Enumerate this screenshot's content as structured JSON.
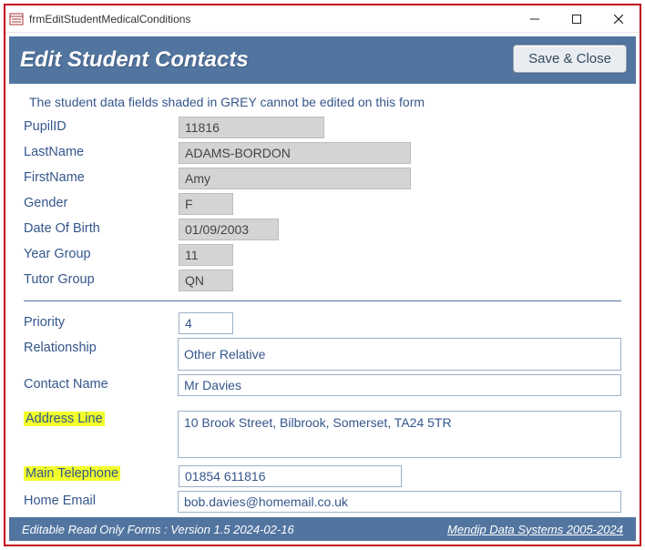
{
  "window": {
    "title": "frmEditStudentMedicalConditions"
  },
  "header": {
    "title": "Edit Student Contacts",
    "save_label": "Save & Close"
  },
  "notice": "The student data fields shaded in GREY cannot be edited on this form",
  "labels": {
    "pupil_id": "PupilID",
    "last_name": "LastName",
    "first_name": "FirstName",
    "gender": "Gender",
    "dob": "Date Of Birth",
    "year_group": "Year Group",
    "tutor_group": "Tutor Group",
    "priority": "Priority",
    "relationship": "Relationship",
    "contact_name": "Contact Name",
    "address_line": "Address Line",
    "main_telephone": "Main Telephone",
    "home_email": "Home Email"
  },
  "fields": {
    "pupil_id": "11816",
    "last_name": "ADAMS-BORDON",
    "first_name": "Amy",
    "gender": "F",
    "dob": "01/09/2003",
    "year_group": "11",
    "tutor_group": "QN",
    "priority": "4",
    "relationship": "Other Relative",
    "contact_name": "Mr Davies",
    "address_line": "10 Brook Street, Bilbrook, Somerset, TA24 5TR",
    "main_telephone": "01854 611816",
    "home_email": "bob.davies@homemail.co.uk"
  },
  "footer": {
    "left": "Editable Read Only Forms :  Version 1.5   2024-02-16",
    "right": "Mendip Data Systems 2005-2024"
  }
}
